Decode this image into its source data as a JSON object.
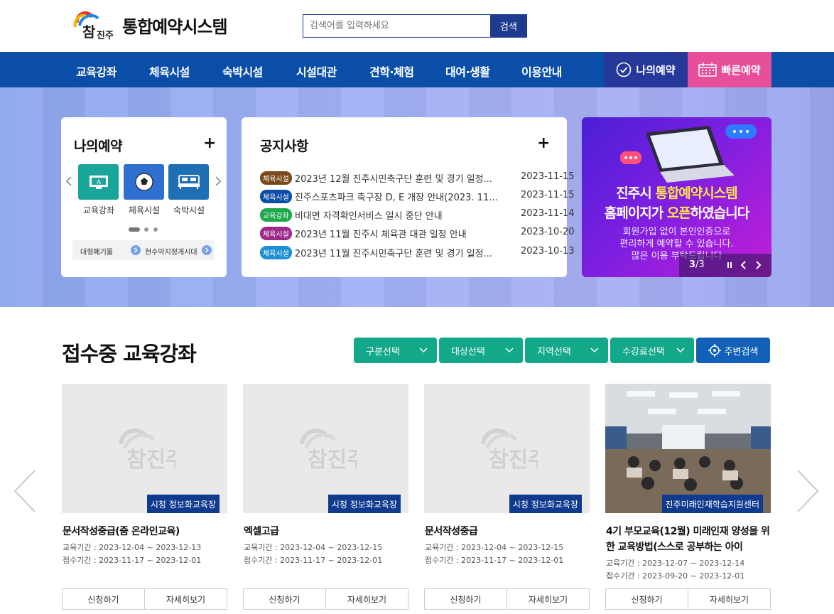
{
  "header": {
    "site_title": "통합예약시스템",
    "search_placeholder": "검색어를 입력하세요",
    "search_button": "검색"
  },
  "nav": {
    "items": [
      "교육강좌",
      "체육시설",
      "숙박시설",
      "시설대관",
      "견학·체험",
      "대여·생활",
      "이용안내"
    ],
    "my_reservation": "나의예약",
    "quick_reservation": "빠른예약"
  },
  "my_card": {
    "title": "나의예약",
    "tiles": [
      "교육강좌",
      "체육시설",
      "숙박시설"
    ],
    "link1": "대형폐기물",
    "link2": "현수막지정게시대"
  },
  "notice_card": {
    "title": "공지사항",
    "rows": [
      {
        "badge": "체육시설",
        "badge_color": "#7a4a1e",
        "text": "2023년 12월 진주시민축구단 훈련 및 경기 일정...",
        "date": "2023-11-15"
      },
      {
        "badge": "체육시설",
        "badge_color": "#0a4ea8",
        "text": "진주스포츠파크 축구장 D, E 개장 안내(2023. 11...",
        "date": "2023-11-15"
      },
      {
        "badge": "교육강좌",
        "badge_color": "#1fa84a",
        "text": "비대면 자격확인서비스 일시 중단 안내",
        "date": "2023-11-14"
      },
      {
        "badge": "체육시설",
        "badge_color": "#9b2a8a",
        "text": "2023년 11월 진주시 체육관 대관 일정 안내",
        "date": "2023-10-20"
      },
      {
        "badge": "체육시설",
        "badge_color": "#1e8fd6",
        "text": "2023년 11월 진주시민축구단 훈련 및 경기 일정...",
        "date": "2023-10-13"
      }
    ]
  },
  "banner": {
    "line1_a": "진주시 ",
    "line1_b": "통합예약시스템",
    "line2_a": "홈페이지가 ",
    "line2_b": "오픈",
    "line2_c": "하였습니다",
    "body1": "회원가입 없이 본인인증으로",
    "body2": "편리하게 예약할 수 있습니다.",
    "body3": "많은 이용 부탁드립니다",
    "page_current": "3",
    "page_total": "/3"
  },
  "section": {
    "title": "접수중 교육강좌",
    "filters": [
      "구분선택",
      "대상선택",
      "지역선택",
      "수강료선택"
    ],
    "nearby": "주변검색"
  },
  "courses": [
    {
      "location": "시청 정보화교육장",
      "title": "문서작성중급(줌 온라인교육)",
      "edu_period": "교육기간 : 2023-12-04 ~ 2023-12-13",
      "apply_period": "접수기간 : 2023-11-17 ~ 2023-12-01",
      "apply": "신청하기",
      "detail": "자세히보기"
    },
    {
      "location": "시청 정보화교육장",
      "title": "엑셀고급",
      "edu_period": "교육기간 : 2023-12-04 ~ 2023-12-15",
      "apply_period": "접수기간 : 2023-11-17 ~ 2023-12-01",
      "apply": "신청하기",
      "detail": "자세히보기"
    },
    {
      "location": "시청 정보화교육장",
      "title": "문서작성중급",
      "edu_period": "교육기간 : 2023-12-04 ~ 2023-12-15",
      "apply_period": "접수기간 : 2023-11-17 ~ 2023-12-01",
      "apply": "신청하기",
      "detail": "자세히보기"
    },
    {
      "location": "진주미래인재학습지원센터",
      "title": "4기 부모교육(12월) 미래인재 양성을 위한 교육방법(스스로 공부하는 아이",
      "edu_period": "교육기간 : 2023-12-07 ~ 2023-12-14",
      "apply_period": "접수기간 : 2023-09-20 ~ 2023-12-01",
      "apply": "신청하기",
      "detail": "자세히보기"
    }
  ],
  "logo_text": "참진주",
  "colors": {
    "nav": "#0a4ea8",
    "my_reservation": "#26399a",
    "quick_reservation": "#e84f9a",
    "filter": "#14a88a",
    "nearby": "#1260b8"
  }
}
